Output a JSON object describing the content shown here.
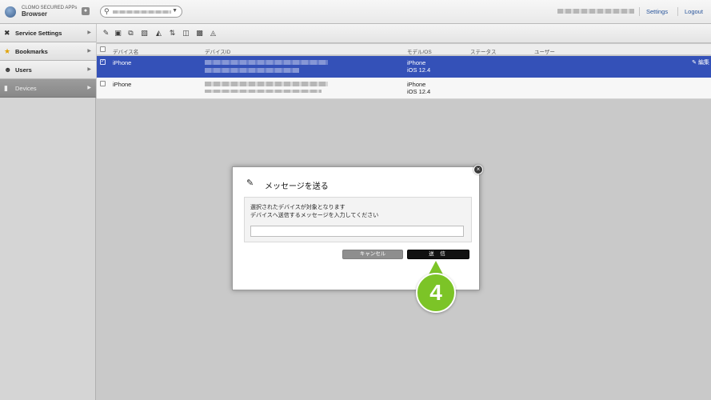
{
  "header": {
    "app_name": "CLOMO SECURED APPs",
    "app_sub": "Browser",
    "links": {
      "settings": "Settings",
      "logout": "Logout"
    }
  },
  "sidebar": {
    "items": [
      {
        "label": "Service Settings",
        "icon": "wrench-screwdriver-icon"
      },
      {
        "label": "Bookmarks",
        "icon": "star-icon"
      },
      {
        "label": "Users",
        "icon": "user-icon"
      },
      {
        "label": "Devices",
        "icon": "device-icon"
      }
    ]
  },
  "grid": {
    "columns": [
      "デバイス名",
      "デバイスID",
      "モデル/OS",
      "ステータス",
      "ユーザー"
    ],
    "rows": [
      {
        "name": "iPhone",
        "model": "iPhone",
        "os": "iOS 12.4",
        "edit": "編集"
      },
      {
        "name": "iPhone",
        "model": "iPhone",
        "os": "iOS 12.4"
      }
    ]
  },
  "modal": {
    "title": "メッセージを送る",
    "desc_line1": "選択されたデバイスが対象となります",
    "desc_line2": "デバイスへ送信するメッセージを入力してください",
    "input_value": "",
    "cancel_label": "キャンセル",
    "send_label": "送 信",
    "close_label": "×"
  },
  "step_badge": "4",
  "colors": {
    "selected_row": "#3451b8",
    "badge_green": "#7cc427",
    "link_blue": "#29559b"
  }
}
